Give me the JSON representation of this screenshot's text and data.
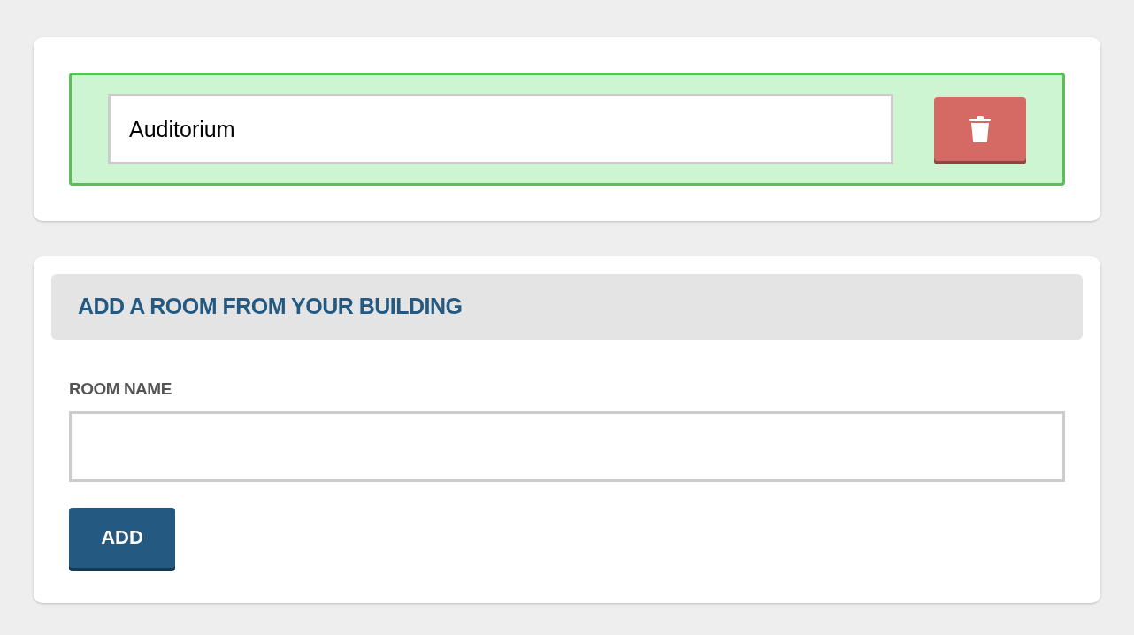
{
  "rooms": [
    {
      "name": "Auditorium"
    }
  ],
  "add_room": {
    "title": "ADD A ROOM FROM YOUR BUILDING",
    "label": "ROOM NAME",
    "button": "ADD"
  }
}
